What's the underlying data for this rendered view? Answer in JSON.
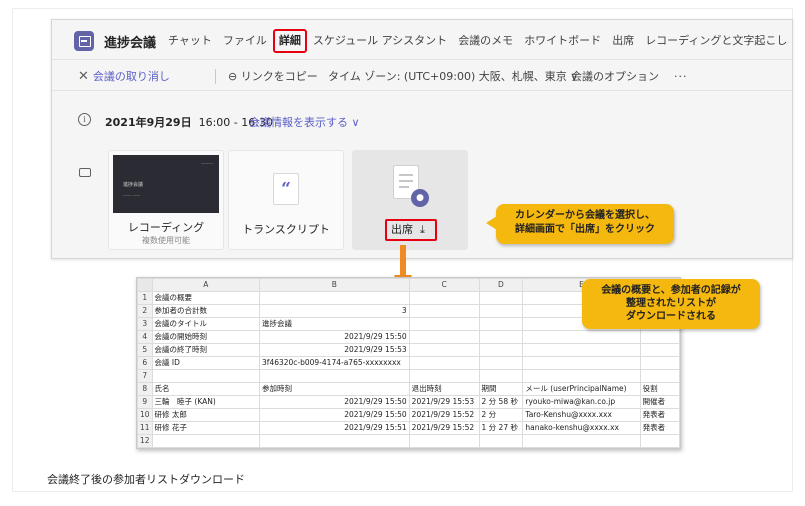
{
  "header": {
    "title": "進捗会議",
    "tabs": [
      {
        "label": "チャット",
        "active": false
      },
      {
        "label": "ファイル",
        "active": false
      },
      {
        "label": "詳細",
        "active": true
      },
      {
        "label": "スケジュール アシスタント",
        "active": false
      },
      {
        "label": "会議のメモ",
        "active": false
      },
      {
        "label": "ホワイトボード",
        "active": false
      },
      {
        "label": "出席",
        "active": false
      },
      {
        "label": "レコーディングと文字起こし",
        "active": false
      }
    ]
  },
  "toolbar": {
    "cancel_label": "会議の取り消し",
    "copy_link_label": "リンクをコピー",
    "timezone_label": "タイム ゾーン: (UTC+09:00) 大阪、札幌、東京",
    "options_label": "会議のオプション",
    "more_label": "···"
  },
  "meeting": {
    "date_label": "2021年9月29日",
    "time_label": "16:00 - 16:30",
    "show_info_label": "会議情報を表示する"
  },
  "cards": {
    "recording_label": "レコーディング",
    "recording_sub": "複数使用可能",
    "transcript_label": "トランスクリプト",
    "attendance_label": "出席",
    "thumb_title": "進捗会議"
  },
  "callouts": {
    "first_line1": "カレンダーから会議を選択し、",
    "first_line2": "詳細画面で「出席」をクリック",
    "second_line1": "会議の概要と、参加者の記録が",
    "second_line2": "整理されたリストが",
    "second_line3": "ダウンロードされる"
  },
  "sheet": {
    "columns": [
      "A",
      "B",
      "C",
      "D",
      "E"
    ],
    "rows": [
      {
        "n": "1",
        "a": "会議の概要",
        "b": "",
        "c": "",
        "d": "",
        "e": "",
        "f": ""
      },
      {
        "n": "2",
        "a": "参加者の合計数",
        "b": "3",
        "c": "",
        "d": "",
        "e": "",
        "f": ""
      },
      {
        "n": "3",
        "a": "会議のタイトル",
        "b": "進捗会議",
        "c": "",
        "d": "",
        "e": "",
        "f": ""
      },
      {
        "n": "4",
        "a": "会議の開始時刻",
        "b": "2021/9/29 15:50",
        "c": "",
        "d": "",
        "e": "",
        "f": ""
      },
      {
        "n": "5",
        "a": "会議の終了時刻",
        "b": "2021/9/29 15:53",
        "c": "",
        "d": "",
        "e": "",
        "f": ""
      },
      {
        "n": "6",
        "a": "会議 ID",
        "b": "3f46320c-b009-4174-a765-xxxxxxxx",
        "c": "",
        "d": "",
        "e": "",
        "f": ""
      },
      {
        "n": "7",
        "a": "",
        "b": "",
        "c": "",
        "d": "",
        "e": "",
        "f": ""
      },
      {
        "n": "8",
        "a": "氏名",
        "b": "参加時刻",
        "c": "退出時刻",
        "d": "期間",
        "e": "メール (userPrincipalName)",
        "f": "役割"
      },
      {
        "n": "9",
        "a": "三輪　睦子 (KAN)",
        "b": "2021/9/29 15:50",
        "c": "2021/9/29 15:53",
        "d": "2 分 58 秒",
        "e": "ryouko-miwa@kan.co.jp",
        "f": "開催者"
      },
      {
        "n": "10",
        "a": "研修 太郎",
        "b": "2021/9/29 15:50",
        "c": "2021/9/29 15:52",
        "d": "2 分",
        "e": "Taro-Kenshu@xxxx.xxx",
        "f": "発表者"
      },
      {
        "n": "11",
        "a": "研修 花子",
        "b": "2021/9/29 15:51",
        "c": "2021/9/29 15:52",
        "d": "1 分 27 秒",
        "e": "hanako-kenshu@xxxx.xx",
        "f": "発表者"
      },
      {
        "n": "12",
        "a": "",
        "b": "",
        "c": "",
        "d": "",
        "e": "",
        "f": ""
      }
    ]
  },
  "caption": "会議終了後の参加者リストダウンロード",
  "colors": {
    "accent": "#5b5fc7",
    "brand": "#6264a7",
    "highlight": "#e60012",
    "callout": "#f5b80f",
    "arrow": "#f08a24"
  }
}
